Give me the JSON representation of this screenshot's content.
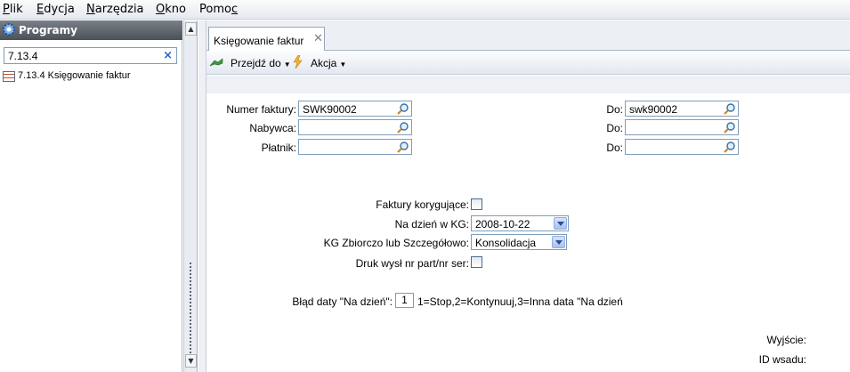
{
  "menu": [
    {
      "pre": "",
      "u": "P",
      "post": "lik"
    },
    {
      "pre": "",
      "u": "E",
      "post": "dycja"
    },
    {
      "pre": "",
      "u": "N",
      "post": "arzędzia"
    },
    {
      "pre": "",
      "u": "O",
      "post": "kno"
    },
    {
      "pre": "Pomo",
      "u": "c",
      "post": ""
    }
  ],
  "sidebar": {
    "title": "Programy",
    "filter_value": "7.13.4",
    "clear_glyph": "×",
    "tree_item_label": "7.13.4   Księgowanie faktur"
  },
  "tab": {
    "label": "Księgowanie faktur",
    "close": "✕"
  },
  "toolbar": {
    "goto_label": "Przejdź do",
    "action_label": "Akcja",
    "caret": "▼"
  },
  "form": {
    "invoice_number_label": "Numer faktury:",
    "invoice_number_value": "SWK90002",
    "invoice_number_to_label": "Do:",
    "invoice_number_to_value": "swk90002",
    "buyer_label": "Nabywca:",
    "buyer_value": "",
    "buyer_to_label": "Do:",
    "buyer_to_value": "",
    "payer_label": "Płatnik:",
    "payer_value": "",
    "payer_to_label": "Do:",
    "payer_to_value": "",
    "correcting_label": "Faktury korygujące:",
    "correcting_checked": false,
    "as_of_label": "Na dzień w KG:",
    "as_of_value": "2008-10-22",
    "gl_mode_label": "KG Zbiorczo lub Szczegółowo:",
    "gl_mode_value": "Konsolidacja",
    "print_label": "Druk wysł nr part/nr ser:",
    "print_checked": false,
    "date_error_label": "Błąd daty \"Na dzień\":",
    "date_error_value": "1",
    "date_error_hint": "1=Stop,2=Kontynuuj,3=Inna data \"Na dzień",
    "exit_label": "Wyjście:",
    "batch_id_label": "ID wsadu:"
  },
  "colors": {
    "accent": "#2a64c8",
    "panel_header": "#4b5158"
  }
}
